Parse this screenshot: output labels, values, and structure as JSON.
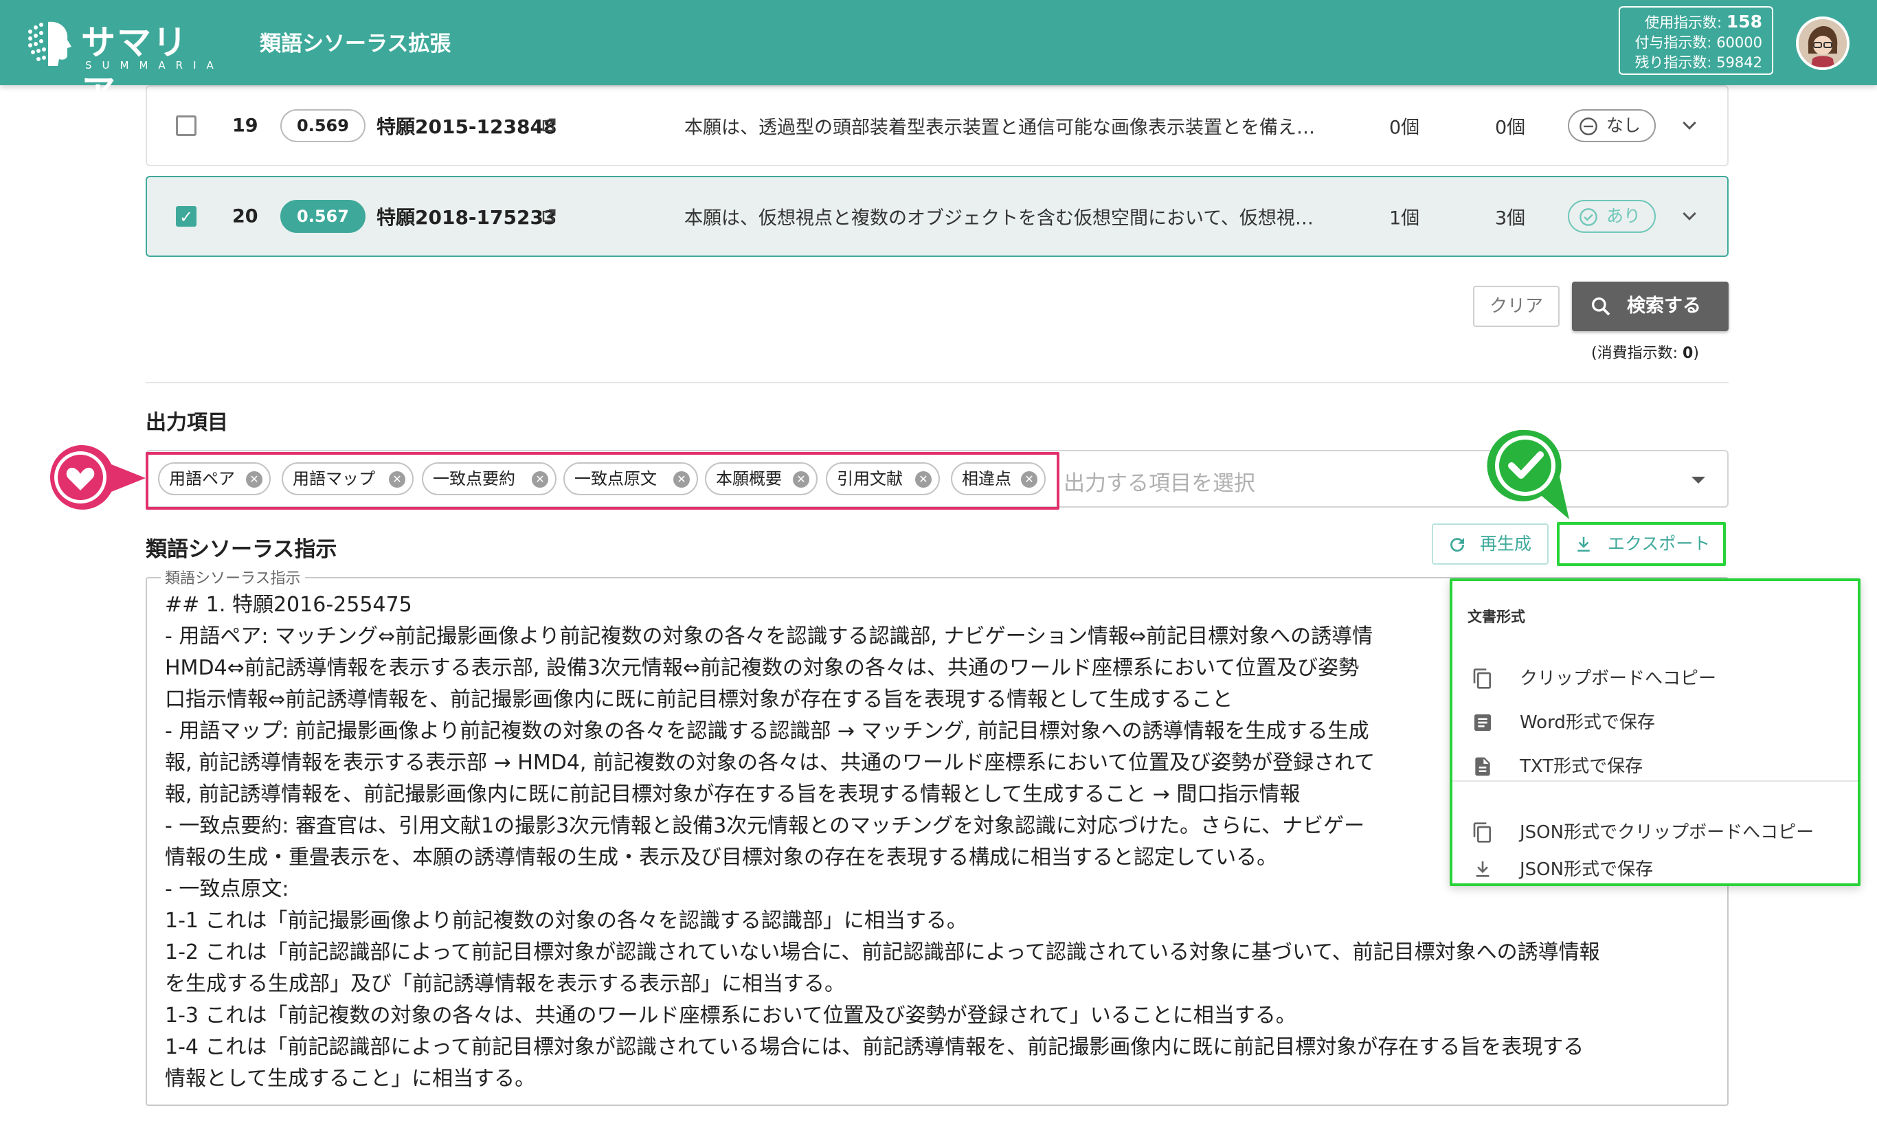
{
  "header": {
    "logo_text": "サマリア",
    "logo_sub": "SUMMARIA",
    "app_title": "類語シソーラス拡張",
    "quota": {
      "used_label": "使用指示数:",
      "used_value": "158",
      "granted": "付与指示数: 60000",
      "remaining": "残り指示数: 59842"
    }
  },
  "rows": [
    {
      "num": "19",
      "score": "0.569",
      "patent": "特願2015-123848",
      "desc": "本願は、透過型の頭部装着型表示装置と通信可能な画像表示装置とを備え…",
      "c1": "0個",
      "c2": "0個",
      "status": "なし",
      "checked": false
    },
    {
      "num": "20",
      "score": "0.567",
      "patent": "特願2018-175233",
      "desc": "本願は、仮想視点と複数のオブジェクトを含む仮想空間において、仮想視…",
      "c1": "1個",
      "c2": "3個",
      "status": "あり",
      "checked": true
    }
  ],
  "actions": {
    "clear": "クリア",
    "search": "検索する",
    "consume_prefix": "(消費指示数: ",
    "consume_value": "0",
    "consume_suffix": ")"
  },
  "output": {
    "title": "出力項目",
    "chips": [
      "用語ペア",
      "用語マップ",
      "一致点要約",
      "一致点原文",
      "本願概要",
      "引用文献",
      "相違点"
    ],
    "placeholder": "出力する項目を選択"
  },
  "thesaurus": {
    "title": "類語シソーラス指示",
    "regen": "再生成",
    "export": "エクスポート",
    "field_label": "類語シソーラス指示",
    "lines": [
      "## 1. 特願2016-255475",
      "- 用語ペア: マッチング⇔前記撮影画像より前記複数の対象の各々を認識する認識部, ナビゲーション情報⇔前記目標対象への誘導情",
      "HMD4⇔前記誘導情報を表示する表示部, 設備3次元情報⇔前記複数の対象の各々は、共通のワールド座標系において位置及び姿勢",
      "口指示情報⇔前記誘導情報を、前記撮影画像内に既に前記目標対象が存在する旨を表現する情報として生成すること",
      "- 用語マップ: 前記撮影画像より前記複数の対象の各々を認識する認識部 → マッチング, 前記目標対象への誘導情報を生成する生成",
      "報, 前記誘導情報を表示する表示部 → HMD4, 前記複数の対象の各々は、共通のワールド座標系において位置及び姿勢が登録されて",
      "報, 前記誘導情報を、前記撮影画像内に既に前記目標対象が存在する旨を表現する情報として生成すること → 間口指示情報",
      "- 一致点要約: 審査官は、引用文献1の撮影3次元情報と設備3次元情報とのマッチングを対象認識に対応づけた。さらに、ナビゲー",
      "情報の生成・重畳表示を、本願の誘導情報の生成・表示及び目標対象の存在を表現する構成に相当すると認定している。",
      "- 一致点原文:",
      "1-1 これは「前記撮影画像より前記複数の対象の各々を認識する認識部」に相当する。",
      "1-2 これは「前記認識部によって前記目標対象が認識されていない場合に、前記認識部によって認識されている対象に基づいて、前記目標対象への誘導情報",
      "を生成する生成部」及び「前記誘導情報を表示する表示部」に相当する。",
      "1-3 これは「前記複数の対象の各々は、共通のワールド座標系において位置及び姿勢が登録されて」いることに相当する。",
      "1-4 これは「前記認識部によって前記目標対象が認識されている場合には、前記誘導情報を、前記撮影画像内に既に前記目標対象が存在する旨を表現する",
      "情報として生成すること」に相当する。"
    ]
  },
  "export_menu": {
    "header": "文書形式",
    "items": [
      "クリップボードへコピー",
      "Word形式で保存",
      "TXT形式で保存",
      "JSON形式でクリップボードへコピー",
      "JSON形式で保存"
    ]
  },
  "colors": {
    "brand": "#3ea99a",
    "highlight_pink": "#e2306c",
    "highlight_green": "#28d33a"
  }
}
